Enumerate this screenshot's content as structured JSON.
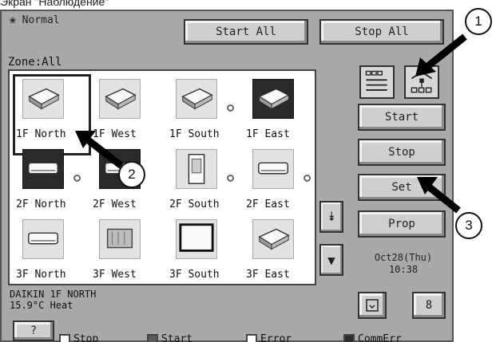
{
  "caption": "Экран \"Наблюдение\"",
  "header": {
    "mode": "❀ Normal",
    "start_all": "Start All",
    "stop_all": "Stop All"
  },
  "zone_label": "Zone:All",
  "units": [
    {
      "label": "1F North",
      "icon": "ceiling-cassette-icon",
      "dark": false,
      "selected": true,
      "dot": false
    },
    {
      "label": "1F West",
      "icon": "ceiling-cassette-icon",
      "dark": false,
      "selected": false,
      "dot": false
    },
    {
      "label": "1F South",
      "icon": "ceiling-cassette-icon",
      "dark": false,
      "selected": false,
      "dot": true
    },
    {
      "label": "1F East",
      "icon": "ceiling-cassette-icon",
      "dark": true,
      "selected": false,
      "dot": false
    },
    {
      "label": "2F North",
      "icon": "wall-mount-unit-icon",
      "dark": true,
      "selected": false,
      "dot": true
    },
    {
      "label": "2F West",
      "icon": "wall-mount-unit-icon",
      "dark": true,
      "selected": false,
      "dot": false
    },
    {
      "label": "2F South",
      "icon": "floor-standing-unit-icon",
      "dark": false,
      "selected": false,
      "dot": true
    },
    {
      "label": "2F East",
      "icon": "wall-mount-unit-icon",
      "dark": false,
      "selected": false,
      "dot": true
    },
    {
      "label": "3F North",
      "icon": "wall-mount-unit-icon",
      "dark": false,
      "selected": false,
      "dot": false
    },
    {
      "label": "3F West",
      "icon": "duct-unit-icon",
      "dark": false,
      "selected": false,
      "dot": false
    },
    {
      "label": "3F South",
      "icon": "panel-unit-icon",
      "dark": false,
      "selected": false,
      "dot": false
    },
    {
      "label": "3F East",
      "icon": "ceiling-cassette-icon",
      "dark": false,
      "selected": false,
      "dot": false
    }
  ],
  "selected_info": {
    "name": "DAIKIN 1F NORTH",
    "status": "15.9°C  Heat"
  },
  "side": {
    "start": "Start",
    "stop": "Stop",
    "set": "Set",
    "prop": "Prop",
    "date": "Oct28(Thu)",
    "time": "10:38",
    "small_right": "8"
  },
  "scroll": {
    "up": "⯯",
    "down": "▼"
  },
  "legend": {
    "help": "?",
    "stop": "Stop",
    "start": "Start",
    "error": "Error",
    "commerr": "CommErr"
  },
  "callouts": [
    "1",
    "2",
    "3"
  ],
  "colors": {
    "panel": "#a9a9a9",
    "button": "#cfcfcf",
    "swatch_start": "#5a5a5a",
    "swatch_stop": "#ffffff",
    "swatch_commerr": "#2e2e2e"
  }
}
